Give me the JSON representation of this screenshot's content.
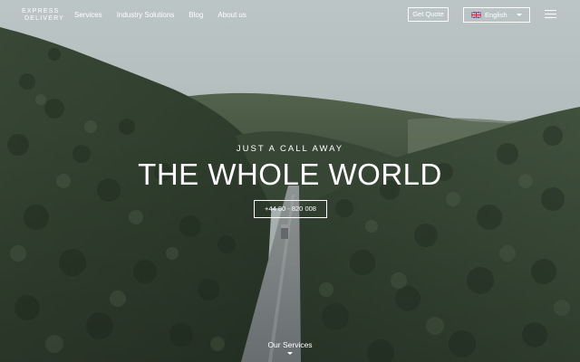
{
  "header": {
    "logo": {
      "line1": "EXPRESS",
      "line2": "DELIVERY"
    },
    "nav": [
      {
        "label": "Services"
      },
      {
        "label": "Industry Solutions"
      },
      {
        "label": "Blog"
      },
      {
        "label": "About us"
      }
    ],
    "quote_label": "Get Quote",
    "language": {
      "selected": "English",
      "flag_icon": "uk-flag-icon"
    },
    "menu_icon": "hamburger-menu-icon"
  },
  "hero": {
    "eyebrow": "JUST A CALL AWAY",
    "headline": "THE WHOLE WORLD",
    "phone": "+44 80 - 820 008",
    "services_link": "Our Services",
    "background": "aerial-forest-road-image"
  },
  "colors": {
    "sky": "#b9c3c4",
    "forest_dark": "#2c3a2c",
    "forest_mid": "#4a5b48",
    "road": "#8a8e90",
    "text": "#ffffff"
  }
}
